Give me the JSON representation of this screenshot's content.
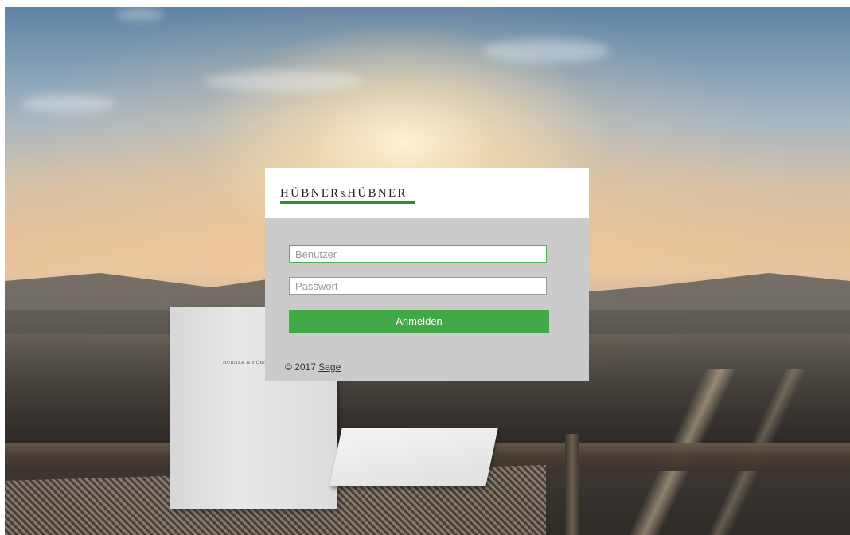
{
  "brand": {
    "name_left": "HÜBNER",
    "ampersand": "&",
    "name_right": "HÜBNER",
    "line_color": "#2f8f2f"
  },
  "folder_mark": "HÜBNER & HÜBNER",
  "login": {
    "username_placeholder": "Benutzer",
    "password_placeholder": "Passwort",
    "submit_label": "Anmelden",
    "button_color": "#40a945",
    "focus_border_color": "#4caf50"
  },
  "footer": {
    "copyright": "© 2017",
    "link_label": "Sage"
  }
}
